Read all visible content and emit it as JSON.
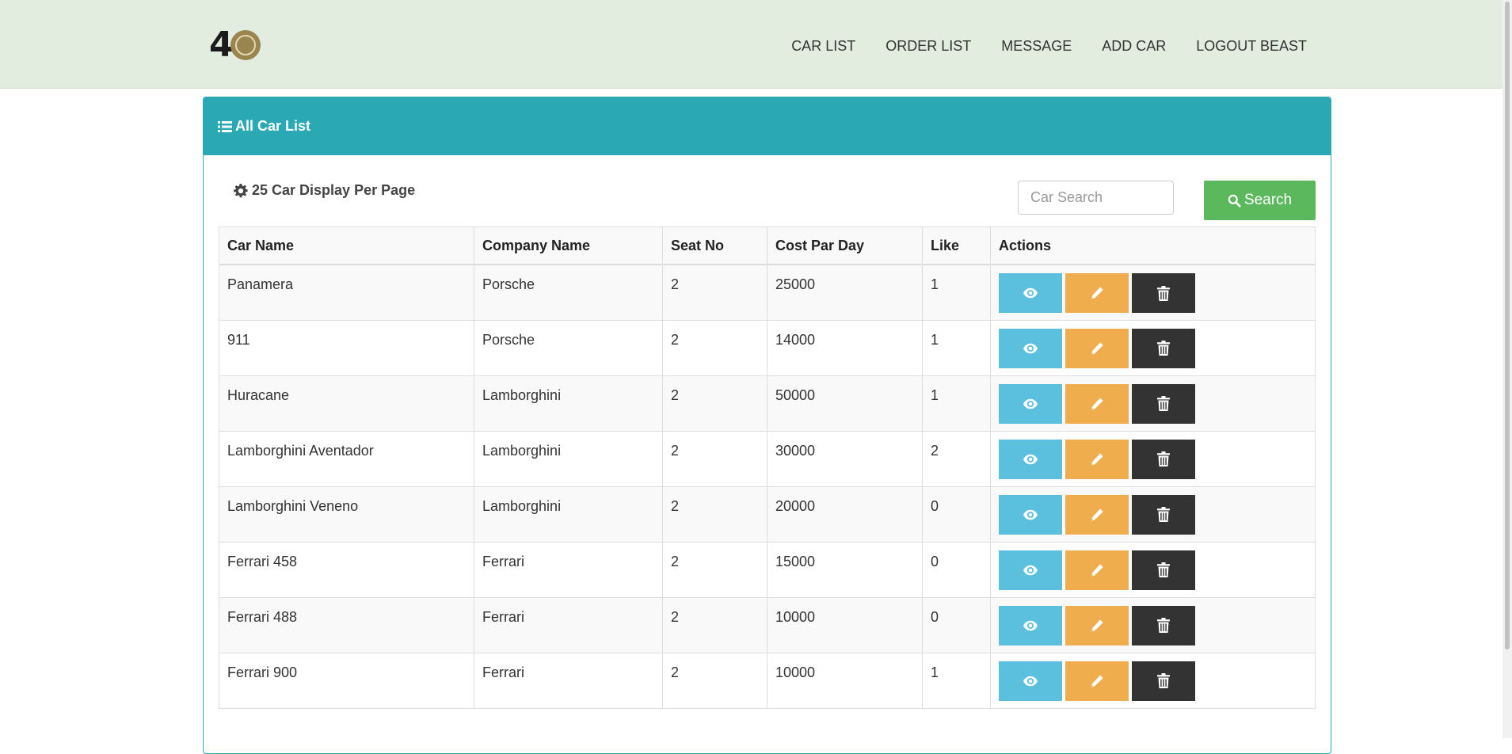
{
  "brand": {
    "logo_text": "4"
  },
  "nav": {
    "items": [
      {
        "label": "CAR LIST"
      },
      {
        "label": "ORDER LIST"
      },
      {
        "label": "MESSAGE"
      },
      {
        "label": "ADD CAR"
      },
      {
        "label": "LOGOUT BEAST"
      }
    ]
  },
  "panel": {
    "title": "All Car List",
    "per_page_label": "25 Car Display Per Page",
    "search": {
      "placeholder": "Car Search",
      "button_label": "Search"
    }
  },
  "table": {
    "headers": [
      "Car Name",
      "Company Name",
      "Seat No",
      "Cost Par Day",
      "Like",
      "Actions"
    ],
    "rows": [
      {
        "car_name": "Panamera",
        "company": "Porsche",
        "seat_no": "2",
        "cost": "25000",
        "like": "1"
      },
      {
        "car_name": "911",
        "company": "Porsche",
        "seat_no": "2",
        "cost": "14000",
        "like": "1"
      },
      {
        "car_name": "Huracane",
        "company": "Lamborghini",
        "seat_no": "2",
        "cost": "50000",
        "like": "1"
      },
      {
        "car_name": "Lamborghini Aventador",
        "company": "Lamborghini",
        "seat_no": "2",
        "cost": "30000",
        "like": "2"
      },
      {
        "car_name": "Lamborghini Veneno",
        "company": "Lamborghini",
        "seat_no": "2",
        "cost": "20000",
        "like": "0"
      },
      {
        "car_name": "Ferrari 458",
        "company": "Ferrari",
        "seat_no": "2",
        "cost": "15000",
        "like": "0"
      },
      {
        "car_name": "Ferrari 488",
        "company": "Ferrari",
        "seat_no": "2",
        "cost": "10000",
        "like": "0"
      },
      {
        "car_name": "Ferrari 900",
        "company": "Ferrari",
        "seat_no": "2",
        "cost": "10000",
        "like": "1"
      }
    ],
    "action_icons": [
      "eye-icon",
      "pencil-icon",
      "trash-icon"
    ]
  },
  "colors": {
    "navbar_bg": "#e2eddf",
    "panel_heading": "#2aa8b3",
    "search_button": "#5cb85c",
    "view_button": "#5bc0de",
    "edit_button": "#f0ad4e",
    "delete_button": "#333333"
  }
}
